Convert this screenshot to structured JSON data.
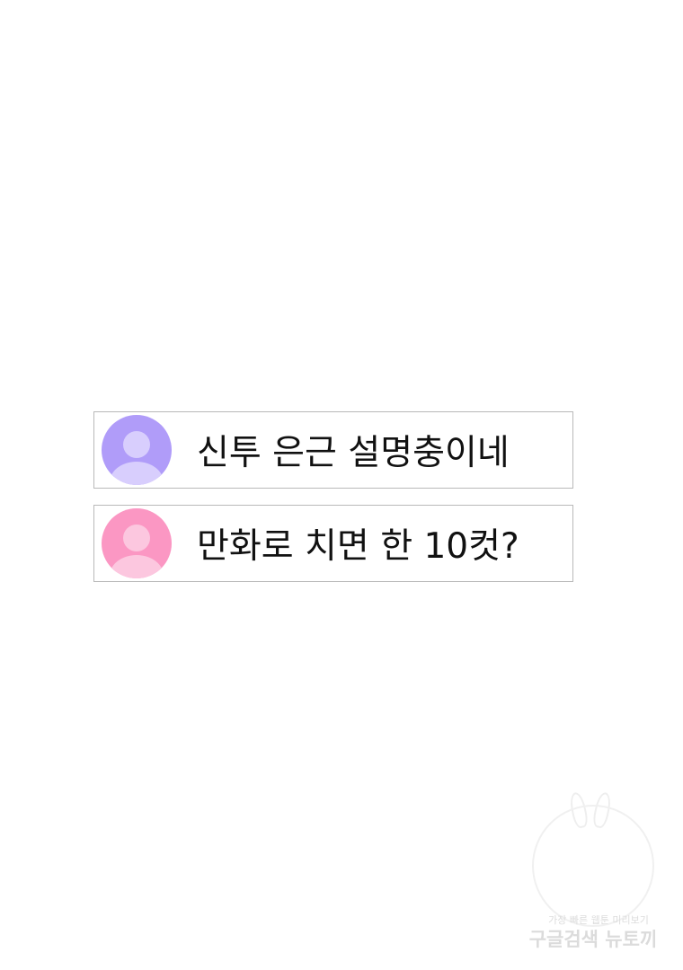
{
  "comments": [
    {
      "text": "신투 은근 설명충이네",
      "avatar_color": "#b09cf9",
      "avatar_icon": "user-avatar-icon"
    },
    {
      "text": "만화로 치면 한 10컷?",
      "avatar_color": "#fb97c3",
      "avatar_icon": "user-avatar-icon"
    }
  ],
  "watermark": {
    "line1": "가장 빠른 웹툰 미리보기",
    "line2": "구글검색 뉴토끼"
  }
}
